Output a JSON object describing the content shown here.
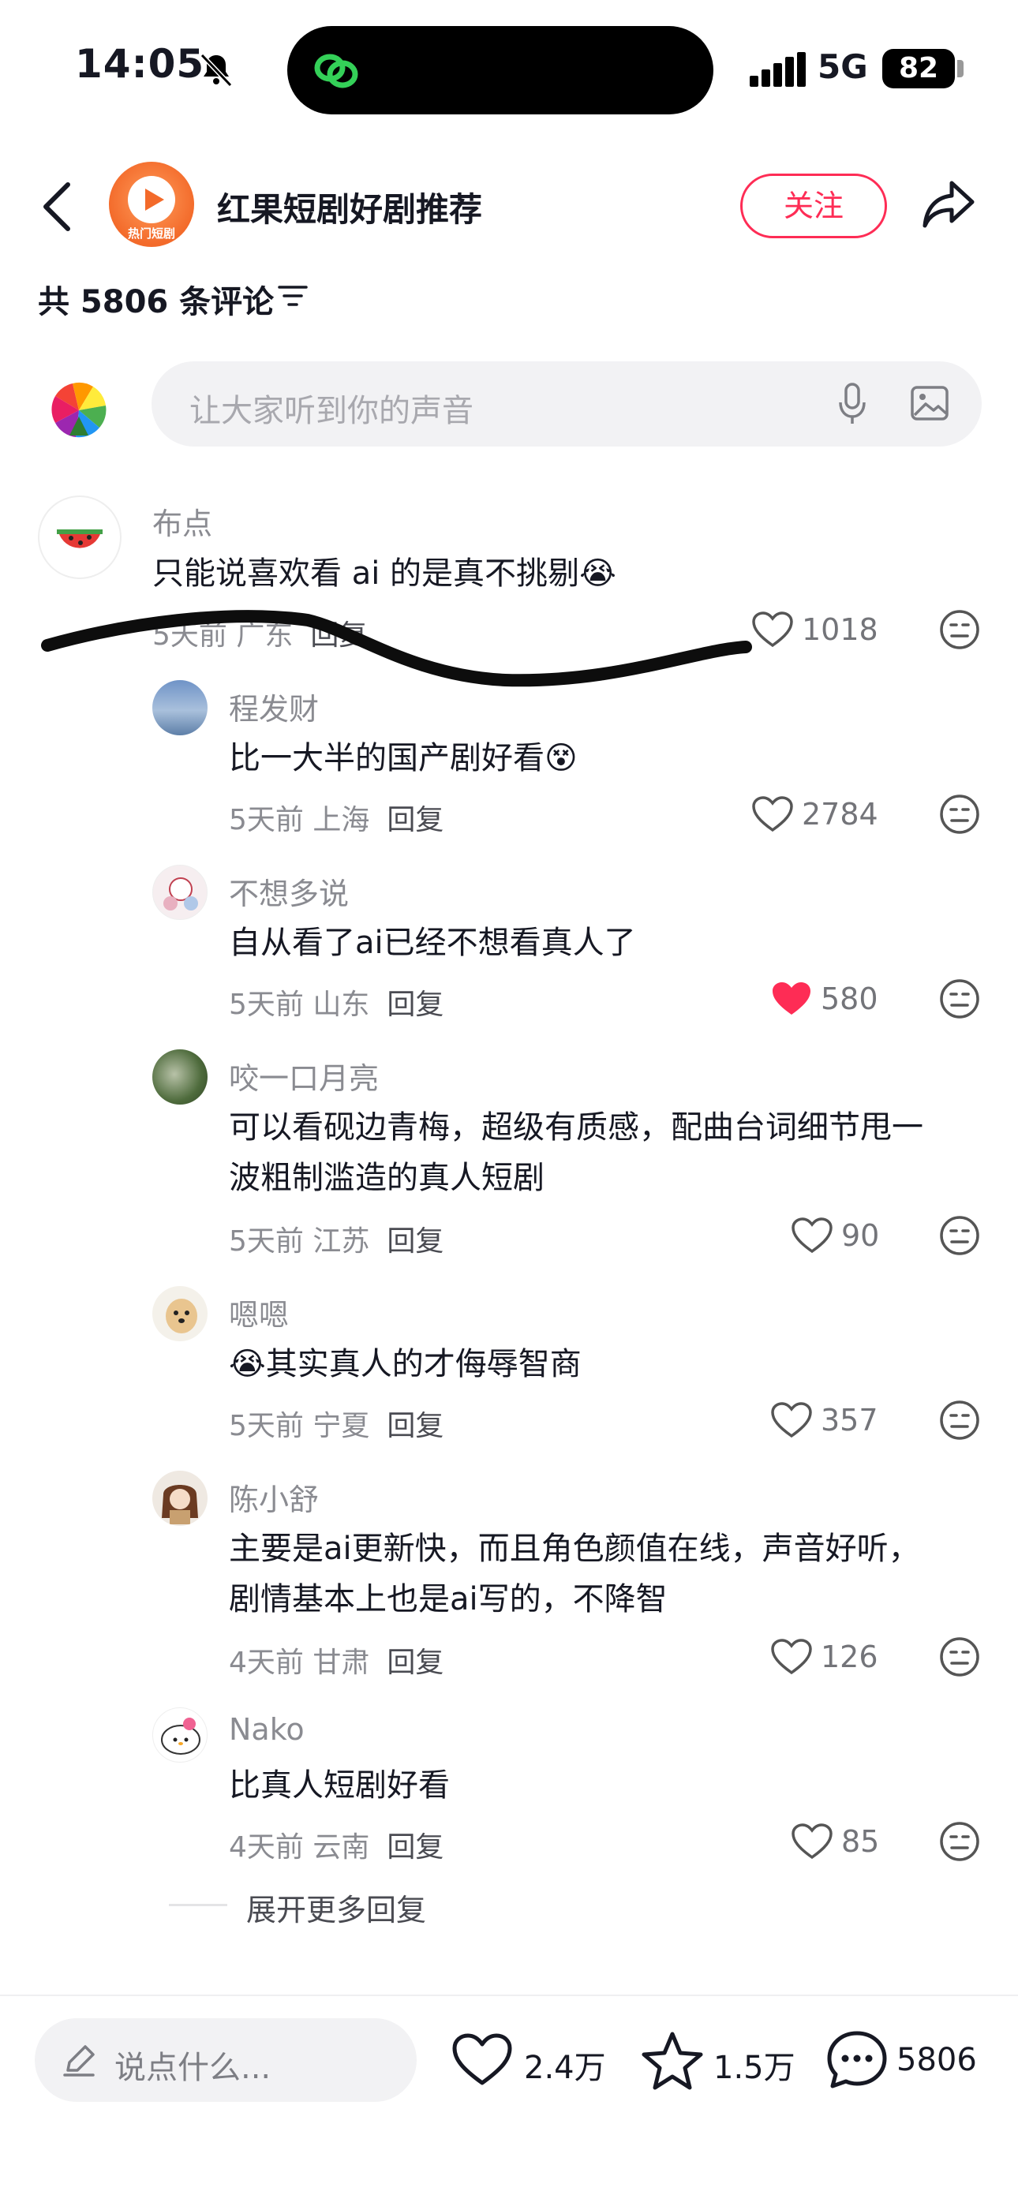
{
  "status_bar": {
    "time": "14:05",
    "network": "5G",
    "battery": "82"
  },
  "header": {
    "channel_name": "红果短剧好剧推荐",
    "logo_label": "热门短剧",
    "follow_label": "关注"
  },
  "comments_header": {
    "count_label": "共 5806 条评论"
  },
  "input": {
    "placeholder": "让大家听到你的声音"
  },
  "comments": [
    {
      "user": "布点",
      "text": "只能说喜欢看 ai 的是真不挑剔",
      "emoji": "😭",
      "time": "5天前",
      "location": "广东",
      "reply": "回复",
      "likes": "1018",
      "liked": false
    },
    {
      "user": "程发财",
      "text": "比一大半的国产剧好看",
      "emoji": "😵",
      "time": "5天前",
      "location": "上海",
      "reply": "回复",
      "likes": "2784",
      "liked": false
    },
    {
      "user": "不想多说",
      "text": "自从看了ai已经不想看真人了",
      "time": "5天前",
      "location": "山东",
      "reply": "回复",
      "likes": "580",
      "liked": true
    },
    {
      "user": "咬一口月亮",
      "text_line1": "可以看砚边青梅，超级有质感，配曲台词细节甩一",
      "text_line2": "波粗制滥造的真人短剧",
      "time": "5天前",
      "location": "江苏",
      "reply": "回复",
      "likes": "90",
      "liked": false
    },
    {
      "user": "嗯嗯",
      "emoji": "😭",
      "text": "其实真人的才侮辱智商",
      "time": "5天前",
      "location": "宁夏",
      "reply": "回复",
      "likes": "357",
      "liked": false
    },
    {
      "user": "陈小舒",
      "text_line1": "主要是ai更新快，而且角色颜值在线，声音好听，",
      "text_line2": "剧情基本上也是ai写的，不降智",
      "time": "4天前",
      "location": "甘肃",
      "reply": "回复",
      "likes": "126",
      "liked": false
    },
    {
      "user": "Nako",
      "text": "比真人短剧好看",
      "time": "4天前",
      "location": "云南",
      "reply": "回复",
      "likes": "85",
      "liked": false
    }
  ],
  "expand_label": "展开更多回复",
  "bottom_bar": {
    "placeholder": "说点什么...",
    "likes": "2.4万",
    "favorites": "1.5万",
    "comments": "5806"
  },
  "colors": {
    "accent": "#fe2c55",
    "text": "#161823",
    "secondary": "#8a8b91"
  },
  "icons": [
    "back-arrow-icon",
    "share-icon",
    "filter-icon",
    "microphone-icon",
    "image-icon",
    "heart-icon",
    "dislike-face-icon",
    "pencil-icon",
    "star-icon",
    "comment-bubble-icon",
    "mute-bell-icon"
  ]
}
